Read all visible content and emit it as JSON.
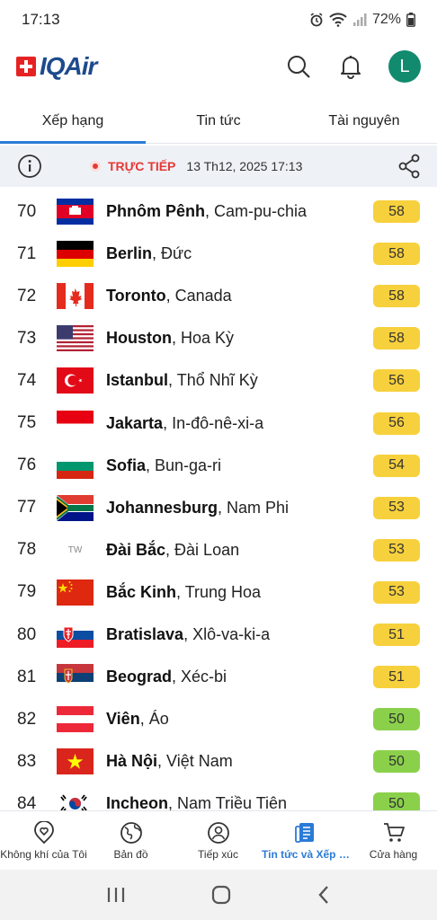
{
  "status_bar": {
    "time": "17:13",
    "battery": "72%"
  },
  "header": {
    "logo_text": "IQAir",
    "avatar_initial": "L"
  },
  "tabs": [
    {
      "label": "Xếp hạng",
      "active": true
    },
    {
      "label": "Tin tức",
      "active": false
    },
    {
      "label": "Tài nguyên",
      "active": false
    }
  ],
  "live": {
    "label": "TRỰC TIẾP",
    "timestamp": "13 Th12, 2025 17:13"
  },
  "rankings": [
    {
      "rank": "70",
      "city": "Phnôm Pênh",
      "country": ", Cam-pu-chia",
      "aqi": "58",
      "level": "moderate",
      "flag": "cambodia"
    },
    {
      "rank": "71",
      "city": "Berlin",
      "country": ", Đức",
      "aqi": "58",
      "level": "moderate",
      "flag": "germany"
    },
    {
      "rank": "72",
      "city": "Toronto",
      "country": ", Canada",
      "aqi": "58",
      "level": "moderate",
      "flag": "canada"
    },
    {
      "rank": "73",
      "city": "Houston",
      "country": ", Hoa Kỳ",
      "aqi": "58",
      "level": "moderate",
      "flag": "usa"
    },
    {
      "rank": "74",
      "city": "Istanbul",
      "country": ", Thổ Nhĩ Kỳ",
      "aqi": "56",
      "level": "moderate",
      "flag": "turkey"
    },
    {
      "rank": "75",
      "city": "Jakarta",
      "country": ", In-đô-nê-xi-a",
      "aqi": "56",
      "level": "moderate",
      "flag": "indonesia"
    },
    {
      "rank": "76",
      "city": "Sofia",
      "country": ", Bun-ga-ri",
      "aqi": "54",
      "level": "moderate",
      "flag": "bulgaria"
    },
    {
      "rank": "77",
      "city": "Johannesburg",
      "country": ", Nam Phi",
      "aqi": "53",
      "level": "moderate",
      "flag": "southafrica"
    },
    {
      "rank": "78",
      "city": "Đài Bắc",
      "country": ", Đài Loan",
      "aqi": "53",
      "level": "moderate",
      "flag": "tw",
      "flag_text": "TW"
    },
    {
      "rank": "79",
      "city": "Bắc Kinh",
      "country": ", Trung Hoa",
      "aqi": "53",
      "level": "moderate",
      "flag": "china"
    },
    {
      "rank": "80",
      "city": "Bratislava",
      "country": ", Xlô-va-ki-a",
      "aqi": "51",
      "level": "moderate",
      "flag": "slovakia"
    },
    {
      "rank": "81",
      "city": "Beograd",
      "country": ", Xéc-bi",
      "aqi": "51",
      "level": "moderate",
      "flag": "serbia"
    },
    {
      "rank": "82",
      "city": "Viên",
      "country": ", Áo",
      "aqi": "50",
      "level": "good",
      "flag": "austria"
    },
    {
      "rank": "83",
      "city": "Hà Nội",
      "country": ", Việt Nam",
      "aqi": "50",
      "level": "good",
      "flag": "vietnam"
    },
    {
      "rank": "84",
      "city": "Incheon",
      "country": ", Nam Triều Tiên",
      "aqi": "50",
      "level": "good",
      "flag": "korea"
    }
  ],
  "bottom_nav": [
    {
      "label": "Không khí của Tôi",
      "icon": "heart-pin-icon",
      "active": false
    },
    {
      "label": "Bản đồ",
      "icon": "globe-icon",
      "active": false
    },
    {
      "label": "Tiếp xúc",
      "icon": "exposure-person-icon",
      "active": false
    },
    {
      "label": "Tin tức và Xếp h...",
      "icon": "news-icon",
      "active": true
    },
    {
      "label": "Cửa hàng",
      "icon": "cart-icon",
      "active": false
    }
  ],
  "colors": {
    "accent": "#2b7bd6",
    "moderate": "#f7d13d",
    "good": "#8bd04b",
    "live": "#e53935",
    "avatar": "#118a6e",
    "brand": "#1d4a8c"
  }
}
